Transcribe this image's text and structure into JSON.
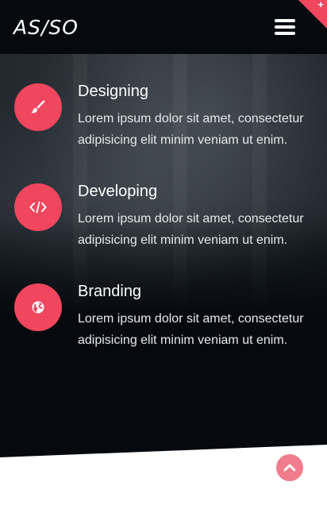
{
  "header": {
    "logo": "AS/SO",
    "menu_icon": "hamburger-menu-icon",
    "corner_symbol": "+"
  },
  "services": [
    {
      "icon": "paint-brush-icon",
      "title": "Designing",
      "description": "Lorem ipsum dolor sit amet, consectetur adipisicing elit minim veniam ut enim."
    },
    {
      "icon": "code-icon",
      "title": "Developing",
      "description": "Lorem ipsum dolor sit amet, consectetur adipisicing elit minim veniam ut enim."
    },
    {
      "icon": "globe-icon",
      "title": "Branding",
      "description": "Lorem ipsum dolor sit amet, consectetur adipisicing elit minim veniam ut enim."
    }
  ],
  "footer": {
    "back_to_top_icon": "chevron-up-icon"
  },
  "colors": {
    "accent": "#f0465e",
    "accent_light": "#f17c8b",
    "background_dark": "#060a0f",
    "text": "#ffffff"
  }
}
